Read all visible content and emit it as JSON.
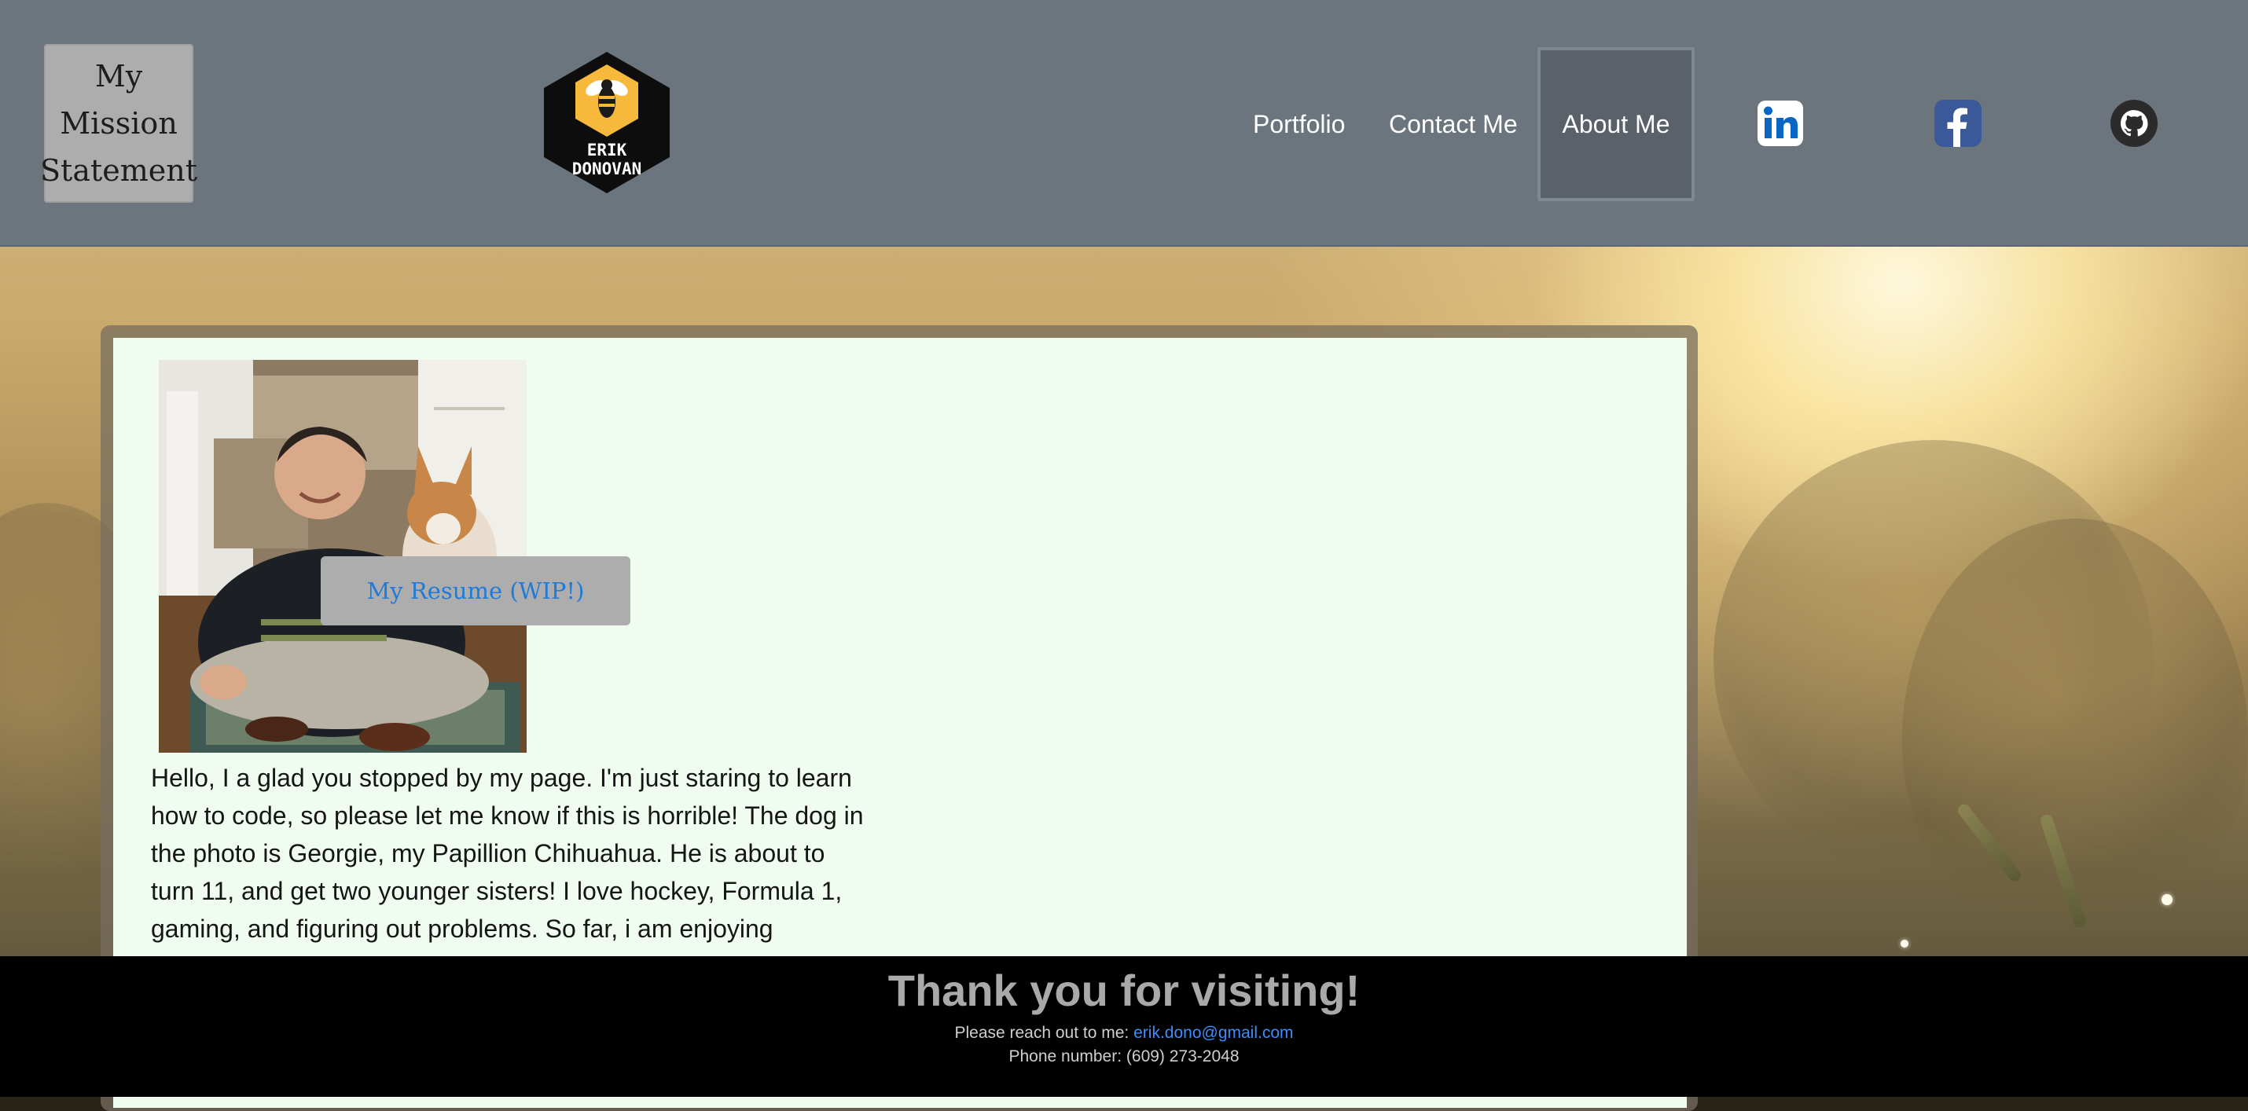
{
  "header": {
    "mission_statement": "My Mission Statement",
    "logo": {
      "line1": "ERIK",
      "line2": "DONOVAN",
      "icon": "bee-icon",
      "color": "#f6b93b"
    },
    "nav": {
      "portfolio": "Portfolio",
      "contact": "Contact Me",
      "about": "About Me"
    },
    "social": {
      "linkedin": "linkedin-icon",
      "facebook": "facebook-icon",
      "github": "github-icon"
    }
  },
  "main": {
    "photo_icon": "profile-photo",
    "resume_label": "My Resume (WIP!)",
    "about_text": "Hello, I a glad you stopped by my page. I'm just staring to learn how to code, so please let me know if this is horrible! The dog in the photo is Georgie, my Papillion Chihuahua. He is about to turn 11, and get two younger sisters! I love hockey, Formula 1, gaming, and figuring out problems. So far, i am enjoying"
  },
  "footer": {
    "title": "Thank you for visiting!",
    "contact_prefix": "Please reach out to me: ",
    "email": "erik.dono@gmail.com",
    "phone": "Phone number: (609) 273-2048"
  },
  "colors": {
    "header_bg": "#6c757d",
    "card_bg": "#f0fcef",
    "link_blue": "#1f7ad8",
    "footer_bg": "#000000"
  }
}
